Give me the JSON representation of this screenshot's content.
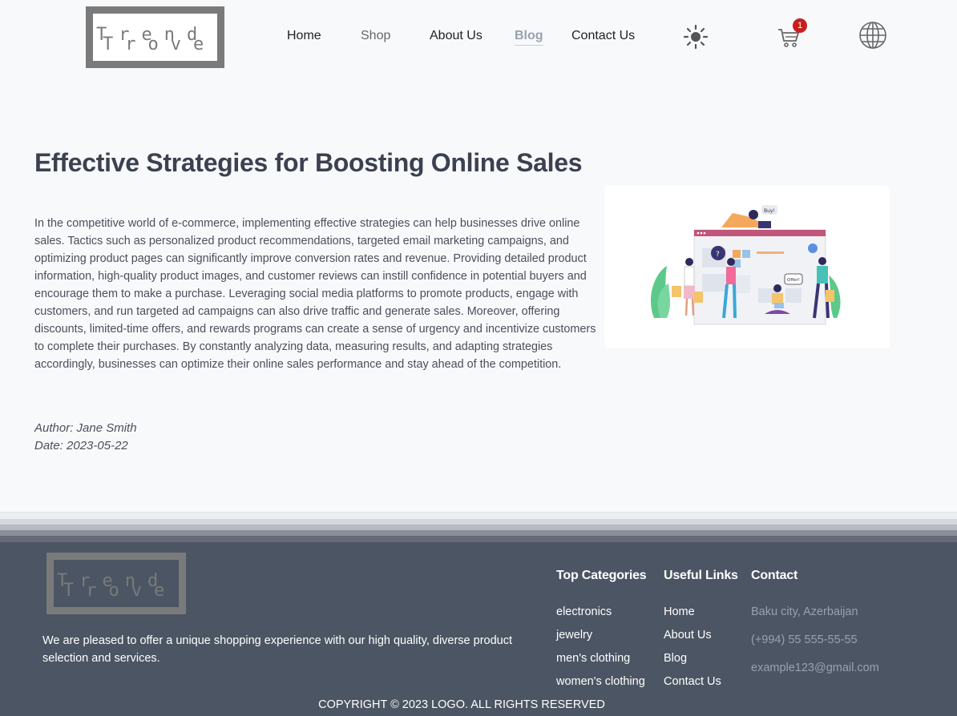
{
  "header": {
    "logo": {
      "line1": "Trend",
      "line2": "Trove"
    },
    "nav": [
      {
        "label": "Home"
      },
      {
        "label": "Shop"
      },
      {
        "label": "About Us"
      },
      {
        "label": "Blog"
      },
      {
        "label": "Contact Us"
      }
    ],
    "icons": {
      "theme": "sun-icon",
      "cart": "cart-icon",
      "language": "globe-icon"
    },
    "cart_count": "1"
  },
  "article": {
    "title": "Effective Strategies for Boosting Online Sales",
    "body": "In the competitive world of e-commerce, implementing effective strategies can help businesses drive online sales. Tactics such as personalized product recommendations, targeted email marketing campaigns, and optimizing product pages can significantly improve conversion rates and revenue. Providing detailed product information, high-quality product images, and customer reviews can instill confidence in potential buyers and encourage them to make a purchase. Leveraging social media platforms to promote products, engage with customers, and run targeted ad campaigns can also drive traffic and generate sales. Moreover, offering discounts, limited-time offers, and rewards programs can create a sense of urgency and incentivize customers to complete their purchases. By constantly analyzing data, measuring results, and adapting strategies accordingly, businesses can optimize their online sales performance and stay ahead of the competition.",
    "author": "Author: Jane Smith",
    "date": "Date: 2023-05-22",
    "illustration": {
      "bubble_buy": "Buy!",
      "bubble_offer": "Offer!",
      "bubble_question": "?"
    }
  },
  "footer": {
    "logo": {
      "line1": "Trend",
      "line2": "Trove"
    },
    "tagline": "We are pleased to offer a unique shopping experience with our high quality, diverse product selection and services.",
    "top_categories": {
      "heading": "Top Categories",
      "items": [
        "electronics",
        "jewelry",
        "men's clothing",
        "women's clothing"
      ]
    },
    "useful_links": {
      "heading": "Useful Links",
      "items": [
        "Home",
        "About Us",
        "Blog",
        "Contact Us"
      ]
    },
    "contact": {
      "heading": "Contact",
      "items": [
        "Baku city, Azerbaijan",
        "(+994) 55 555-55-55",
        "example123@gmail.com"
      ]
    },
    "copyright": "COPYRIGHT © 2023 LOGO. ALL RIGHTS RESERVED"
  },
  "colors": {
    "page_bg": "#f8f9fb",
    "footer_bg": "#4b5563",
    "title": "#3b4150",
    "badge": "#c81e1e",
    "active_nav": "#9aa0b0"
  }
}
